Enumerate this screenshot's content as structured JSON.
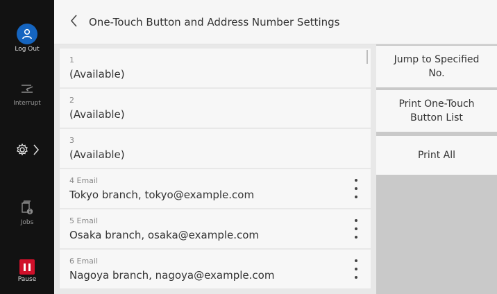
{
  "rail": {
    "logout_label": "Log Out",
    "interrupt_label": "Interrupt",
    "jobs_label": "Jobs",
    "pause_label": "Pause"
  },
  "header": {
    "title": "One-Touch Button and Address Number Settings"
  },
  "entries": [
    {
      "number": "1",
      "value": "(Available)",
      "has_menu": false
    },
    {
      "number": "2",
      "value": "(Available)",
      "has_menu": false
    },
    {
      "number": "3",
      "value": "(Available)",
      "has_menu": false
    },
    {
      "number": "4 Email",
      "value": "Tokyo branch, tokyo@example.com",
      "has_menu": true
    },
    {
      "number": "5 Email",
      "value": "Osaka branch, osaka@example.com",
      "has_menu": true
    },
    {
      "number": "6 Email",
      "value": "Nagoya branch, nagoya@example.com",
      "has_menu": true
    }
  ],
  "side": {
    "jump_label": "Jump to Specified No.",
    "print_list_label": "Print One-Touch Button List",
    "print_all_label": "Print All"
  },
  "colors": {
    "rail_bg": "#121212",
    "logout_blue": "#1565c0",
    "pause_red": "#d0102a"
  }
}
